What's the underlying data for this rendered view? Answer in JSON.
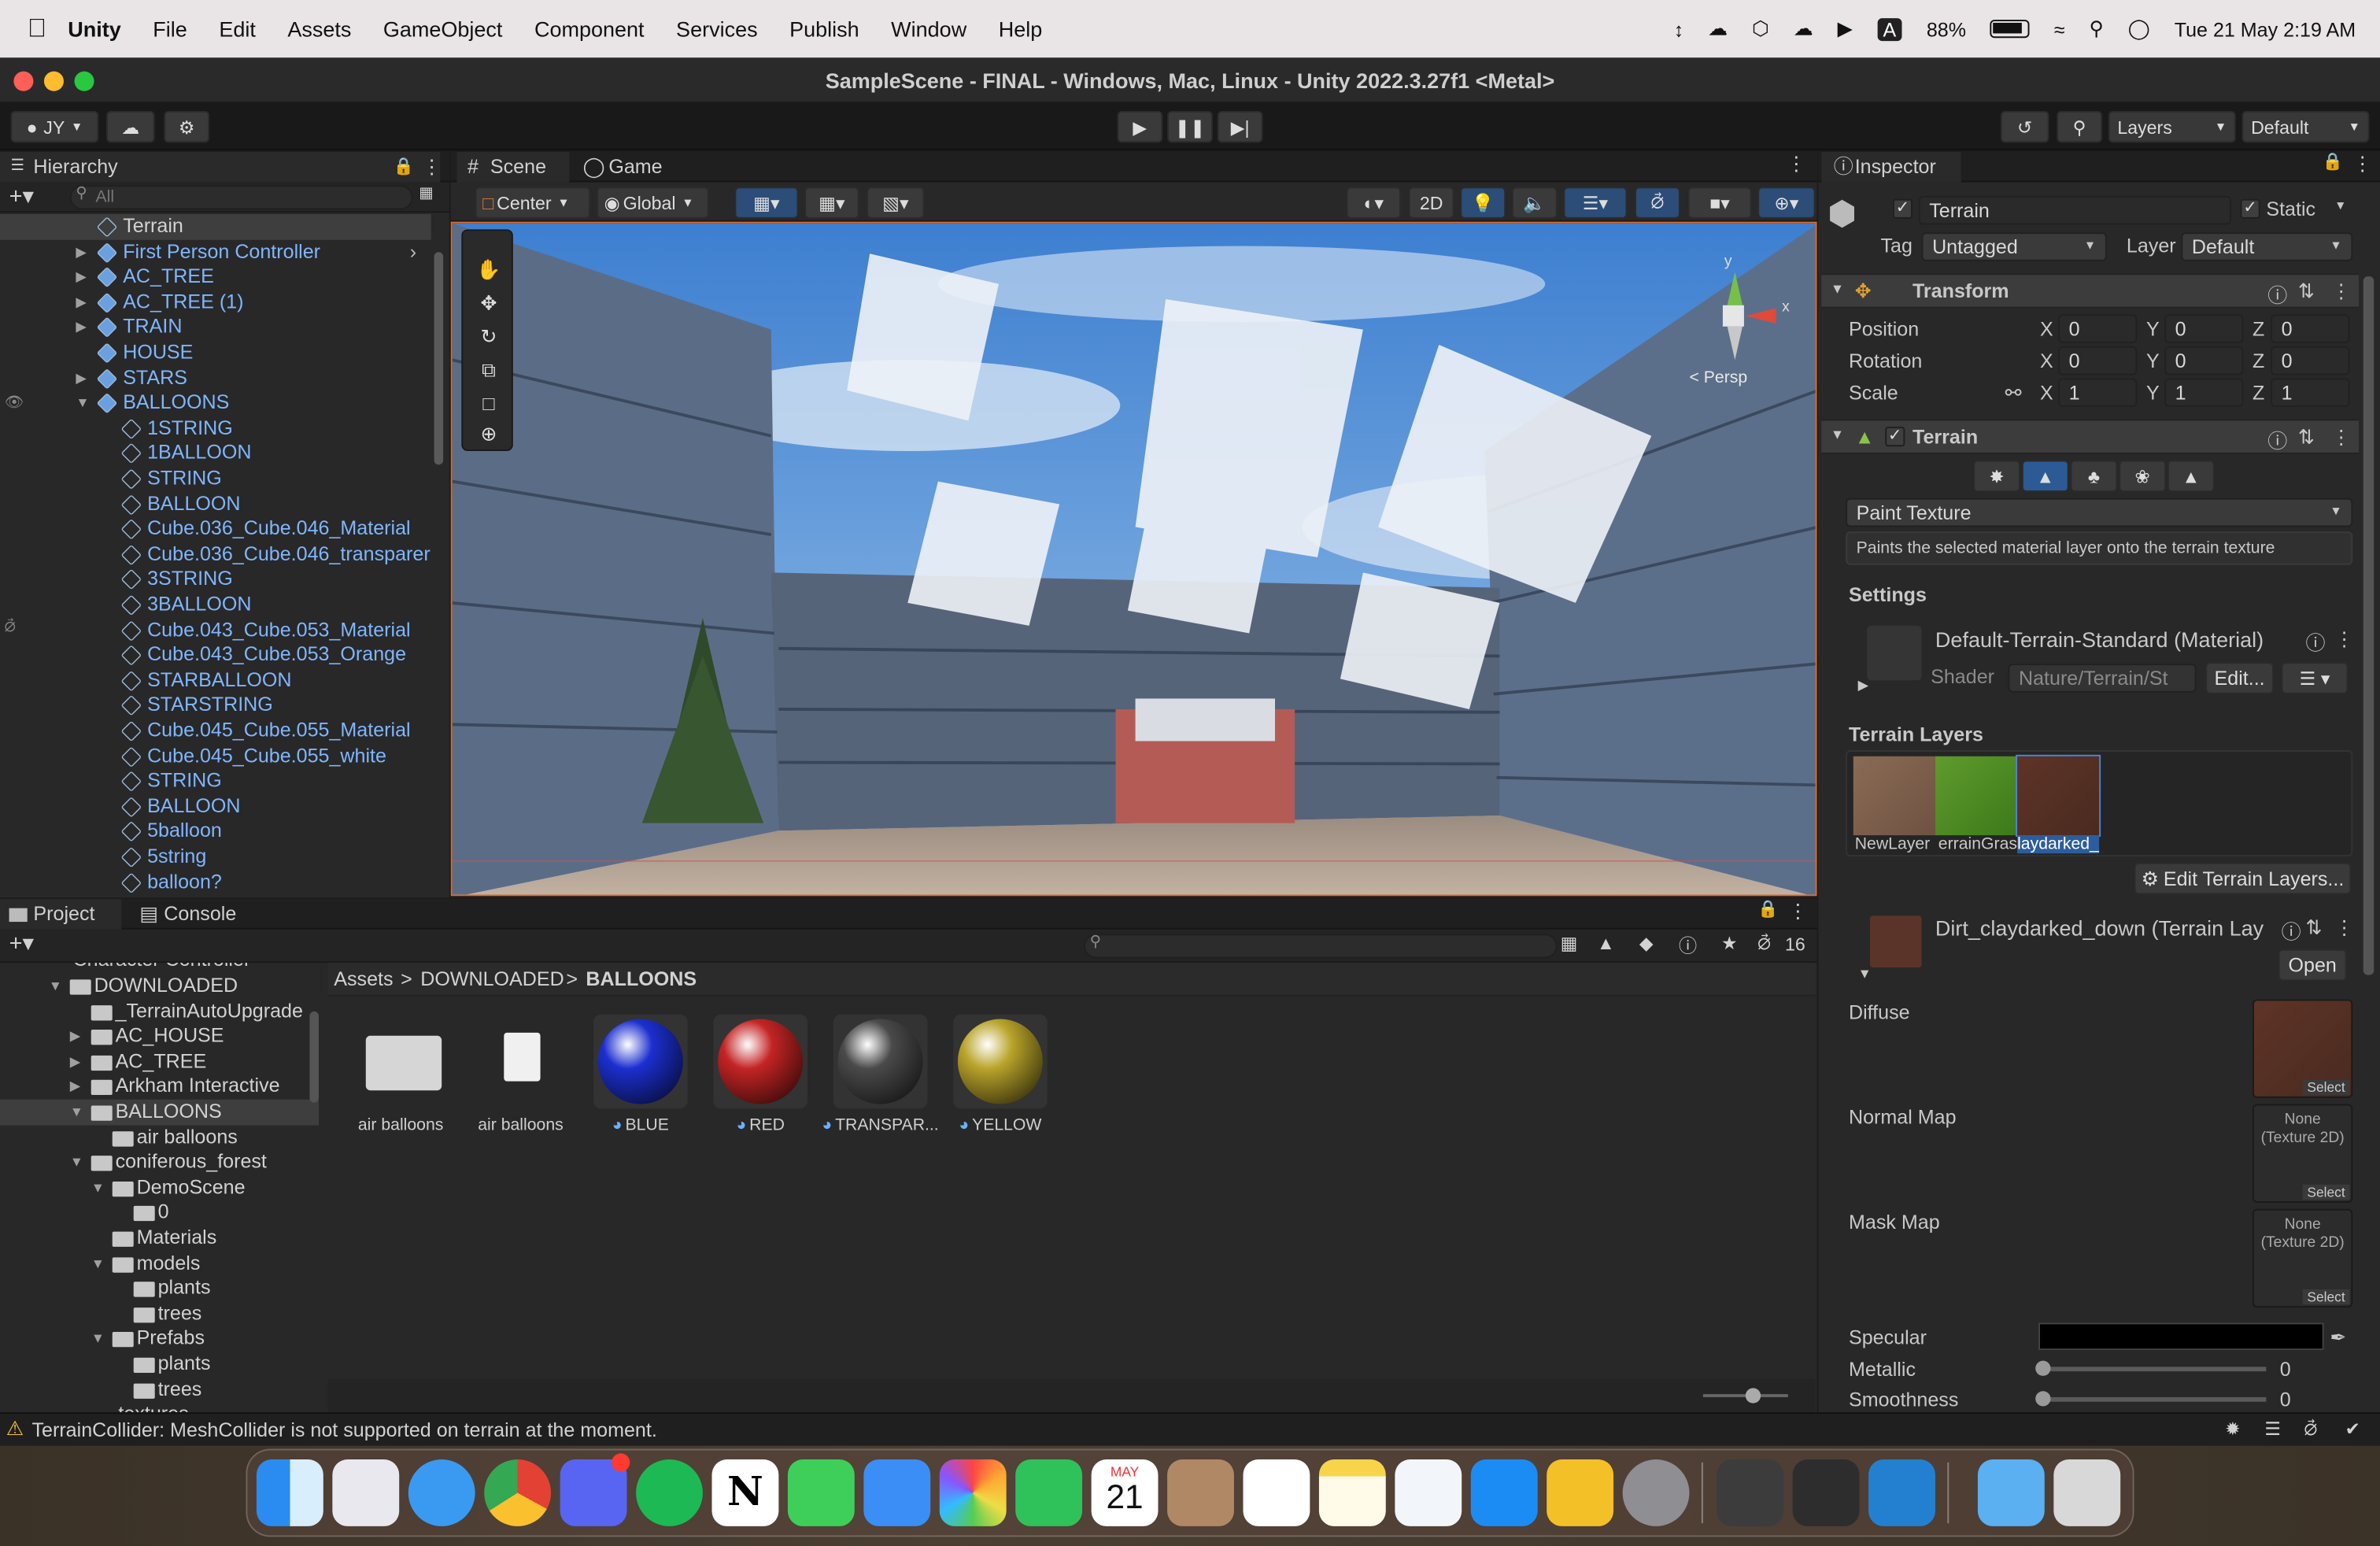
{
  "menubar": {
    "app": "Unity",
    "items": [
      "File",
      "Edit",
      "Assets",
      "GameObject",
      "Component",
      "Services",
      "Publish",
      "Window",
      "Help"
    ],
    "battery": "88%",
    "datetime": "Tue 21 May  2:19 AM",
    "input_indicator": "A"
  },
  "window": {
    "title": "SampleScene - FINAL - Windows, Mac, Linux - Unity 2022.3.27f1 <Metal>"
  },
  "toolbar": {
    "account": "JY",
    "layers": "Layers",
    "layout": "Default"
  },
  "hierarchy": {
    "tab": "Hierarchy",
    "search_placeholder": "All",
    "items": [
      {
        "label": "Terrain",
        "indent": 0,
        "arrow": "",
        "blue": false,
        "selected": true
      },
      {
        "label": "First Person Controller",
        "indent": 0,
        "arrow": "▶",
        "blue": true
      },
      {
        "label": "AC_TREE",
        "indent": 0,
        "arrow": "▶",
        "blue": true
      },
      {
        "label": "AC_TREE (1)",
        "indent": 0,
        "arrow": "▶",
        "blue": true
      },
      {
        "label": "TRAIN",
        "indent": 0,
        "arrow": "▶",
        "blue": true
      },
      {
        "label": "HOUSE",
        "indent": 0,
        "arrow": "",
        "blue": true
      },
      {
        "label": "STARS",
        "indent": 0,
        "arrow": "▶",
        "blue": true
      },
      {
        "label": "BALLOONS",
        "indent": 0,
        "arrow": "▼",
        "blue": true
      },
      {
        "label": "1STRING",
        "indent": 1,
        "arrow": "",
        "blue": true
      },
      {
        "label": "1BALLOON",
        "indent": 1,
        "arrow": "",
        "blue": true
      },
      {
        "label": "STRING",
        "indent": 1,
        "arrow": "",
        "blue": true
      },
      {
        "label": "BALLOON",
        "indent": 1,
        "arrow": "",
        "blue": true
      },
      {
        "label": "Cube.036_Cube.046_Material",
        "indent": 1,
        "arrow": "",
        "blue": true
      },
      {
        "label": "Cube.036_Cube.046_transparer",
        "indent": 1,
        "arrow": "",
        "blue": true
      },
      {
        "label": "3STRING",
        "indent": 1,
        "arrow": "",
        "blue": true
      },
      {
        "label": "3BALLOON",
        "indent": 1,
        "arrow": "",
        "blue": true
      },
      {
        "label": "Cube.043_Cube.053_Material",
        "indent": 1,
        "arrow": "",
        "blue": true
      },
      {
        "label": "Cube.043_Cube.053_Orange",
        "indent": 1,
        "arrow": "",
        "blue": true
      },
      {
        "label": "STARBALLOON",
        "indent": 1,
        "arrow": "",
        "blue": true
      },
      {
        "label": "STARSTRING",
        "indent": 1,
        "arrow": "",
        "blue": true
      },
      {
        "label": "Cube.045_Cube.055_Material",
        "indent": 1,
        "arrow": "",
        "blue": true
      },
      {
        "label": "Cube.045_Cube.055_white",
        "indent": 1,
        "arrow": "",
        "blue": true
      },
      {
        "label": "STRING",
        "indent": 1,
        "arrow": "",
        "blue": true
      },
      {
        "label": "BALLOON",
        "indent": 1,
        "arrow": "",
        "blue": true
      },
      {
        "label": "5balloon",
        "indent": 1,
        "arrow": "",
        "blue": true
      },
      {
        "label": "5string",
        "indent": 1,
        "arrow": "",
        "blue": true
      },
      {
        "label": "balloon?",
        "indent": 1,
        "arrow": "",
        "blue": true
      }
    ]
  },
  "scene": {
    "tab_scene": "Scene",
    "tab_game": "Game",
    "pivot": "Center",
    "space": "Global",
    "mode_2d": "2D",
    "gizmo_view": "< Persp",
    "gizmo_axis_y": "y",
    "gizmo_axis_x": "x"
  },
  "inspector": {
    "tab": "Inspector",
    "object_name": "Terrain",
    "static_label": "Static",
    "tag_label": "Tag",
    "tag_value": "Untagged",
    "layer_label": "Layer",
    "layer_value": "Default",
    "transform": {
      "title": "Transform",
      "rows": [
        {
          "label": "Position",
          "x": "0",
          "y": "0",
          "z": "0"
        },
        {
          "label": "Rotation",
          "x": "0",
          "y": "0",
          "z": "0"
        },
        {
          "label": "Scale",
          "x": "1",
          "y": "1",
          "z": "1"
        }
      ],
      "axis_x": "X",
      "axis_y": "Y",
      "axis_z": "Z"
    },
    "terrain": {
      "title": "Terrain",
      "tool": "Paint Texture",
      "help": "Paints the selected material layer onto the terrain texture",
      "settings": "Settings",
      "material": "Default-Terrain-Standard (Material)",
      "shader_label": "Shader",
      "shader_value": "Nature/Terrain/St",
      "edit_button": "Edit...",
      "layers_title": "Terrain Layers",
      "layer_names": [
        "NewLayer",
        "errainGras",
        "laydarked_"
      ],
      "edit_layers_button": "Edit Terrain Layers...",
      "layer_asset": "Dirt_claydarked_down (Terrain Lay",
      "open_button": "Open",
      "maps": [
        {
          "label": "Diffuse",
          "value": "",
          "select": "Select"
        },
        {
          "label": "Normal Map",
          "value": "None\n(Texture 2D)",
          "select": "Select"
        },
        {
          "label": "Mask Map",
          "value": "None\n(Texture 2D)",
          "select": "Select"
        }
      ],
      "specular": "Specular",
      "metallic": "Metallic",
      "metallic_value": "0",
      "smoothness": "Smoothness",
      "smoothness_value": "0"
    }
  },
  "project": {
    "tab_project": "Project",
    "tab_console": "Console",
    "hidden_count": "16",
    "breadcrumb": [
      "Assets",
      "DOWNLOADED",
      "BALLOONS"
    ],
    "tree": [
      {
        "label": "DOWNLOADED",
        "indent": 1,
        "arrow": "▼"
      },
      {
        "label": "_TerrainAutoUpgrade",
        "indent": 2,
        "arrow": ""
      },
      {
        "label": "AC_HOUSE",
        "indent": 2,
        "arrow": "▶"
      },
      {
        "label": "AC_TREE",
        "indent": 2,
        "arrow": "▶"
      },
      {
        "label": "Arkham Interactive",
        "indent": 2,
        "arrow": "▶"
      },
      {
        "label": "BALLOONS",
        "indent": 2,
        "arrow": "▼",
        "selected": true
      },
      {
        "label": "air balloons",
        "indent": 3,
        "arrow": ""
      },
      {
        "label": "coniferous_forest",
        "indent": 2,
        "arrow": "▼"
      },
      {
        "label": "DemoScene",
        "indent": 3,
        "arrow": "▼"
      },
      {
        "label": "0",
        "indent": 4,
        "arrow": ""
      },
      {
        "label": "Materials",
        "indent": 3,
        "arrow": ""
      },
      {
        "label": "models",
        "indent": 3,
        "arrow": "▼"
      },
      {
        "label": "plants",
        "indent": 4,
        "arrow": ""
      },
      {
        "label": "trees",
        "indent": 4,
        "arrow": ""
      },
      {
        "label": "Prefabs",
        "indent": 3,
        "arrow": "▼"
      },
      {
        "label": "plants",
        "indent": 4,
        "arrow": ""
      },
      {
        "label": "trees",
        "indent": 4,
        "arrow": ""
      }
    ],
    "tree_top_partial": "Character Controller",
    "tree_bottom_partial": "textures",
    "assets": [
      {
        "label": "air balloons",
        "kind": "folder"
      },
      {
        "label": "air balloons",
        "kind": "file"
      },
      {
        "label": "BLUE",
        "kind": "material",
        "color": "#1c2fd0"
      },
      {
        "label": "RED",
        "kind": "material",
        "color": "#c42424"
      },
      {
        "label": "TRANSPAR...",
        "kind": "material",
        "color": "#4a4a4a"
      },
      {
        "label": "YELLOW",
        "kind": "material",
        "color": "#b9a42a"
      }
    ]
  },
  "status": {
    "warning": "TerrainCollider: MeshCollider is not supported on terrain at the moment."
  },
  "dock": {
    "calendar_month": "MAY",
    "calendar_day": "21"
  }
}
